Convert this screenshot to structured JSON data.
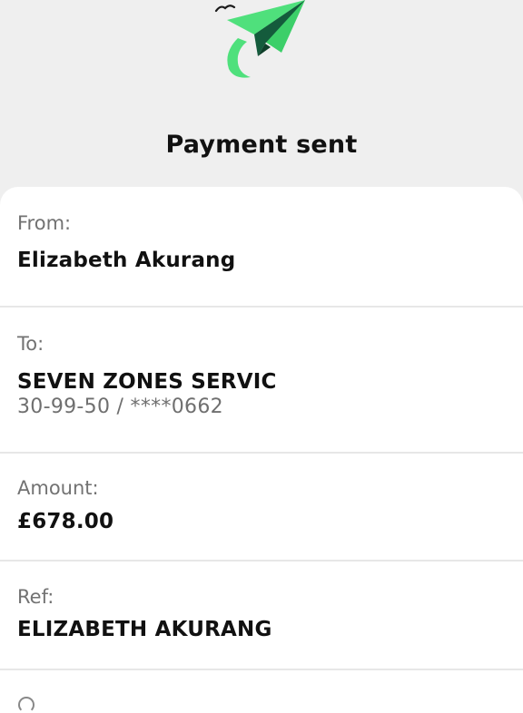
{
  "header": {
    "title": "Payment sent",
    "icon": "paper-plane-icon",
    "colors": {
      "plane_light": "#4fe07c",
      "plane_dark": "#145b3c",
      "bird": "#1a1a1a"
    }
  },
  "details": {
    "from": {
      "label": "From:",
      "value": "Elizabeth Akurang"
    },
    "to": {
      "label": "To:",
      "value": "SEVEN ZONES SERVIC",
      "account": "30-99-50 / ****0662"
    },
    "amount": {
      "label": "Amount:",
      "value": "£678.00"
    },
    "ref": {
      "label": "Ref:",
      "value": "ELIZABETH AKURANG"
    }
  }
}
